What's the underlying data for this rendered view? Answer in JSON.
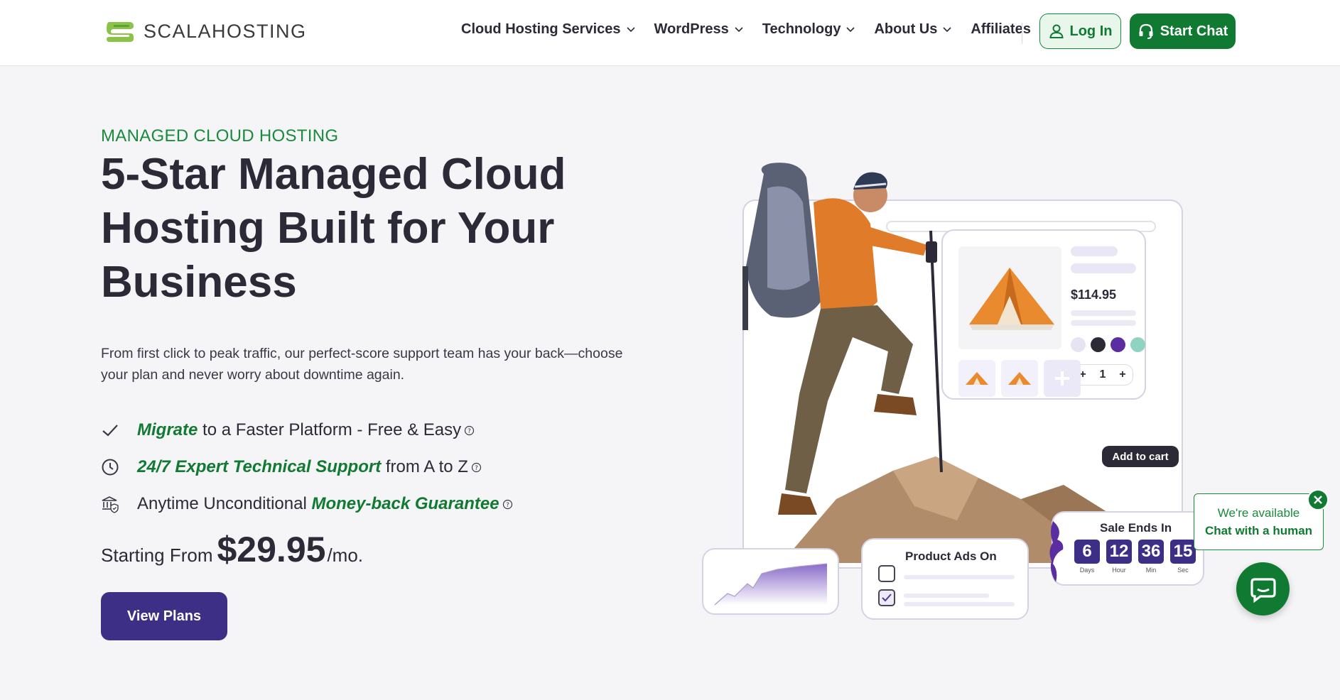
{
  "brand": {
    "name": "SCALAHOSTING"
  },
  "nav": {
    "items": [
      {
        "label": "Cloud Hosting Services",
        "dropdown": true
      },
      {
        "label": "WordPress",
        "dropdown": true
      },
      {
        "label": "Technology",
        "dropdown": true
      },
      {
        "label": "About Us",
        "dropdown": true
      },
      {
        "label": "Affiliates",
        "dropdown": false
      }
    ],
    "login_label": "Log In",
    "chat_label": "Start Chat"
  },
  "hero": {
    "eyebrow": "MANAGED CLOUD HOSTING",
    "title_line1": "5-Star Managed Cloud",
    "title_line2": "Hosting Built for Your",
    "title_line3": "Business",
    "intro": "From first click to peak traffic, our perfect-score support team has your back—choose your plan and never worry about downtime again.",
    "features": [
      {
        "icon": "check-icon",
        "highlight": "Migrate",
        "text": " to a Faster Platform - Free & Easy"
      },
      {
        "icon": "clock-icon",
        "highlight": "24/7 Expert Technical Support",
        "text": " from A to Z"
      },
      {
        "icon": "bank-shield-icon",
        "prefix": "Anytime Unconditional ",
        "highlight": "Money-back Guarantee"
      }
    ],
    "price_prefix": "Starting From",
    "price_amount": "$29.95",
    "price_suffix": "/mo.",
    "cta_label": "View Plans"
  },
  "illustration": {
    "product_price": "$114.95",
    "quantity": "1",
    "add_to_cart": "Add to cart",
    "ads_title": "Product Ads On",
    "sale_title": "Sale Ends In",
    "countdown": [
      {
        "value": "6",
        "label": "Days"
      },
      {
        "value": "12",
        "label": "Hour"
      },
      {
        "value": "36",
        "label": "Min"
      },
      {
        "value": "15",
        "label": "Sec"
      }
    ]
  },
  "chat_widget": {
    "line1": "We're available",
    "line2": "Chat with a human"
  },
  "colors": {
    "brand_green": "#117a32",
    "accent_purple": "#3d2f86",
    "text_dark": "#2d2a38"
  }
}
